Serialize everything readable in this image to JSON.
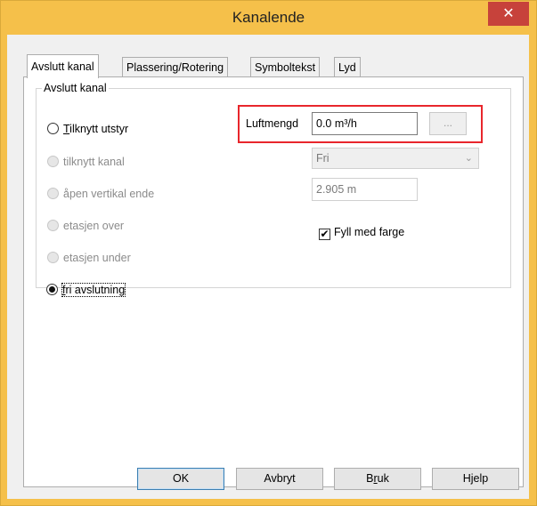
{
  "window": {
    "title": "Kanalende",
    "close_glyph": "✕"
  },
  "tabs": [
    {
      "label": "Avslutt kanal",
      "active": true
    },
    {
      "label": "Plassering/Rotering",
      "active": false
    },
    {
      "label": "Symboltekst",
      "active": false
    },
    {
      "label": "Lyd",
      "active": false
    }
  ],
  "group": {
    "label": "Avslutt kanal",
    "radios": [
      {
        "label_mnemonic": "T",
        "label_rest": "ilknytt utstyr",
        "enabled": true,
        "checked": false
      },
      {
        "label": "tilknytt kanal",
        "enabled": false,
        "checked": false
      },
      {
        "label": "åpen vertikal ende",
        "enabled": false,
        "checked": false
      },
      {
        "label": "etasjen over",
        "enabled": false,
        "checked": false
      },
      {
        "label": "etasjen under",
        "enabled": false,
        "checked": false
      },
      {
        "label_mnemonic": "f",
        "label_rest": "ri avslutning",
        "enabled": true,
        "checked": true
      }
    ],
    "airflow": {
      "label": "Luftmengd",
      "value": "0.0 m³/h",
      "browse_label": "..."
    },
    "kanal_select": {
      "value": "Fri"
    },
    "height_value": "2.905 m",
    "fill_checkbox": {
      "label": "Fyll med farge",
      "checked": true,
      "check_glyph": "✔"
    }
  },
  "buttons": {
    "ok": "OK",
    "cancel": "Avbryt",
    "apply_pre": "B",
    "apply_mnemonic": "r",
    "apply_post": "uk",
    "help": "Hjelp"
  },
  "colors": {
    "titlebar": "#f5c04a",
    "close": "#c7423b",
    "highlight": "#e8262c"
  }
}
